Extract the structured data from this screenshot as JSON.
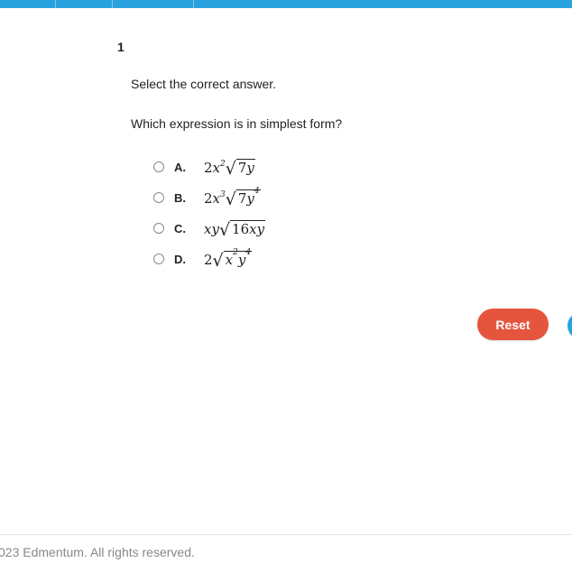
{
  "question": {
    "number": "1",
    "instruction": "Select the correct answer.",
    "prompt": "Which expression is in simplest form?"
  },
  "options": [
    {
      "letter": "A.",
      "coef": "2",
      "var1": "x",
      "exp1": "2",
      "radicand_num": "7",
      "radicand_var": "y",
      "radicand_exp": ""
    },
    {
      "letter": "B.",
      "coef": "2",
      "var1": "x",
      "exp1": "3",
      "radicand_num": "7",
      "radicand_var": "y",
      "radicand_exp": "4"
    },
    {
      "letter": "C.",
      "coef": "",
      "var1": "xy",
      "exp1": "",
      "radicand_num": "16",
      "radicand_var": "xy",
      "radicand_exp": ""
    },
    {
      "letter": "D.",
      "coef": "2",
      "var1": "",
      "exp1": "",
      "radicand_num": "",
      "radicand_var": "x",
      "radicand_exp": "2",
      "radicand_var2": "y",
      "radicand_exp2": "4"
    }
  ],
  "buttons": {
    "reset": "Reset"
  },
  "footer": {
    "copyright": "023 Edmentum. All rights reserved."
  },
  "colors": {
    "accent": "#29a3dd",
    "reset": "#e5553e"
  }
}
